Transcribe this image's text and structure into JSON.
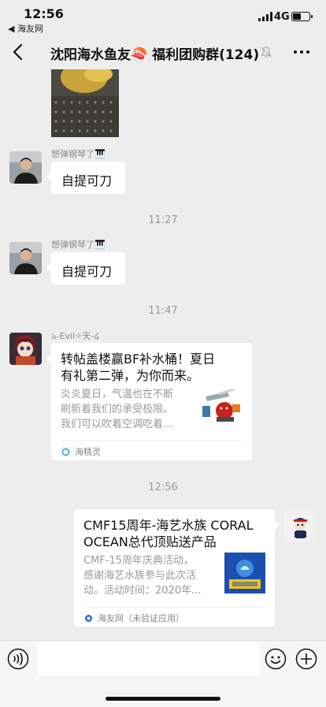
{
  "status_bar": {
    "time": "12:56",
    "back_app": "◀ 海友网",
    "network": "4G",
    "battery_level": 0.55
  },
  "header": {
    "title": "沈阳海水鱼友🍣 福利团购群(124)"
  },
  "messages": [
    {
      "sender": "想弹钢琴了🎹",
      "text": "自提可刀"
    },
    {
      "sender": "想弹钢琴了🎹",
      "text": "自提可刀"
    }
  ],
  "time_separators": [
    "11:27",
    "11:47",
    "12:56"
  ],
  "link_card_1": {
    "sender": "ঌ-Evil✧天-໒",
    "title_lines": [
      "转帖盖楼赢BF补水桶！夏日",
      "有礼第二弹，为你而来。"
    ],
    "desc_lines": [
      "炎炎夏日，气温也在不断",
      "刷新着我们的承受极限。",
      "我们可以吹着空调吃着..."
    ],
    "source": "海精灵"
  },
  "link_card_2": {
    "title_lines": [
      "CMF15周年-海艺水族 CORAL",
      "OCEAN总代顶贴送产品"
    ],
    "desc_lines": [
      "CMF-15周年庆典活动，",
      "感谢海艺水族参与此次活",
      "动。活动时间：2020年..."
    ],
    "source": "海友网（未验证应用）"
  },
  "icons": [
    "back-arrow-icon",
    "mute-icon",
    "more-icon",
    "voice-icon",
    "emoji-icon",
    "plus-icon"
  ],
  "colors": {
    "background": "#ededed",
    "bubble": "#ffffff",
    "timestamp": "#9a9a9a"
  }
}
